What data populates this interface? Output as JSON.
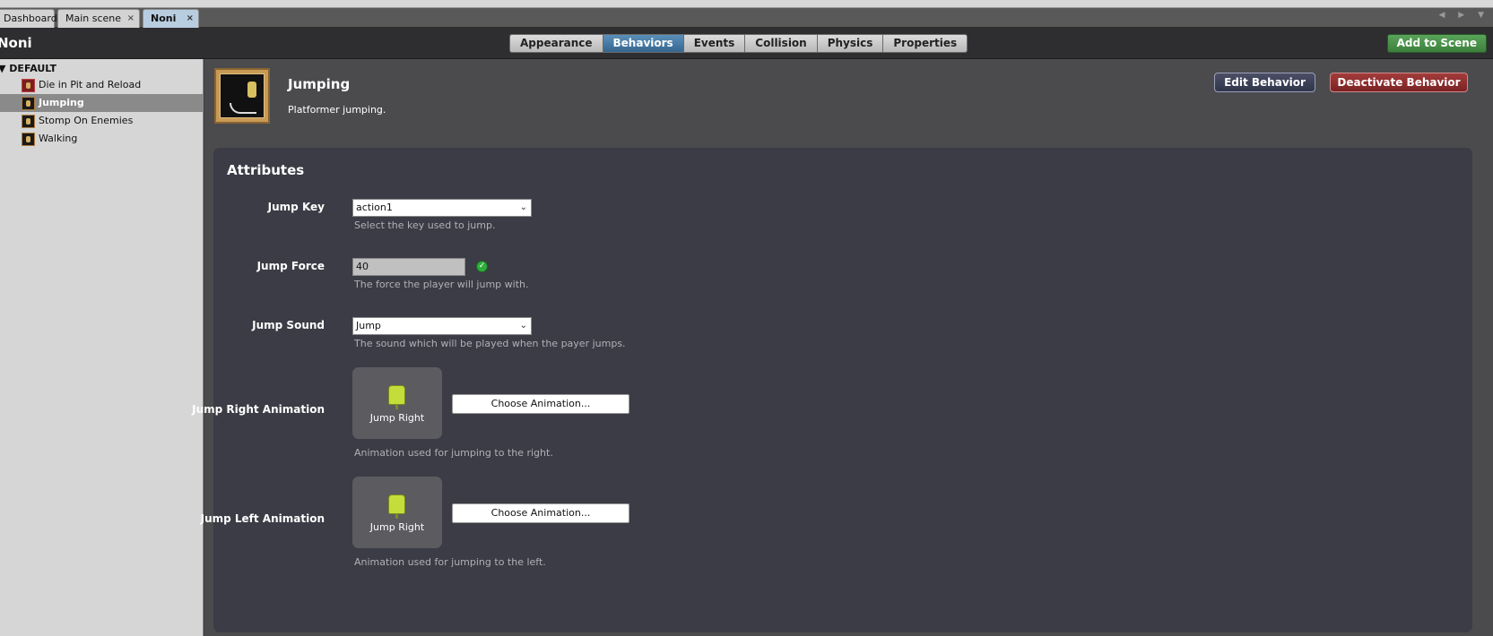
{
  "doc_tabs": [
    {
      "label": "Dashboard",
      "closable": false
    },
    {
      "label": "Main scene",
      "closable": true
    },
    {
      "label": "Noni",
      "closable": true,
      "active": true
    }
  ],
  "close_glyph": "×",
  "tab_nav_glyphs": "◀ ▶ ▼",
  "header": {
    "actor_name": "Noni",
    "mode_tabs": [
      "Appearance",
      "Behaviors",
      "Events",
      "Collision",
      "Physics",
      "Properties"
    ],
    "active_mode": "Behaviors",
    "add_to_scene": "Add to Scene"
  },
  "sidebar": {
    "group": "DEFAULT",
    "items": [
      {
        "label": "Die in Pit and Reload",
        "icon": "skull-icon"
      },
      {
        "label": "Jumping",
        "icon": "jump-icon",
        "active": true
      },
      {
        "label": "Stomp On Enemies",
        "icon": "stomp-icon"
      },
      {
        "label": "Walking",
        "icon": "walk-icon"
      }
    ]
  },
  "behavior": {
    "title": "Jumping",
    "description": "Platformer jumping.",
    "edit_button": "Edit Behavior",
    "deactivate_button": "Deactivate Behavior"
  },
  "attributes": {
    "title": "Attributes",
    "jump_key": {
      "label": "Jump Key",
      "value": "action1",
      "help": "Select the key used to jump."
    },
    "jump_force": {
      "label": "Jump Force",
      "value": "40",
      "help": "The force the player will jump with."
    },
    "jump_sound": {
      "label": "Jump Sound",
      "value": "Jump",
      "help": "The sound which will be played when the payer jumps."
    },
    "jump_right_animation": {
      "label": "Jump Right Animation",
      "animation": "Jump Right",
      "button": "Choose Animation...",
      "help": "Animation used for jumping to the right."
    },
    "jump_left_animation": {
      "label": "Jump Left Animation",
      "animation": "Jump Right",
      "button": "Choose Animation...",
      "help": "Animation used for jumping to the left."
    }
  },
  "colors": {
    "accent_tab": "#36678f",
    "add_button": "#3c7f3c",
    "deactivate": "#7a2222"
  }
}
